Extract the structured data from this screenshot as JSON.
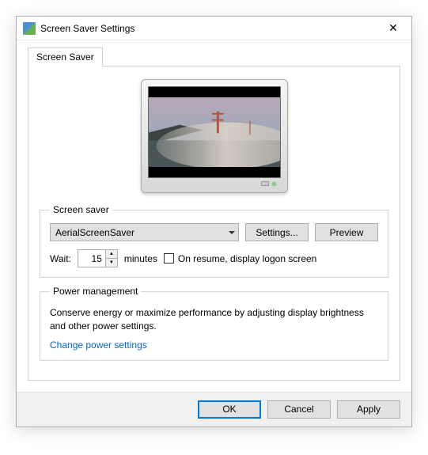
{
  "window": {
    "title": "Screen Saver Settings"
  },
  "tab": {
    "label": "Screen Saver"
  },
  "screensaver_group": {
    "legend": "Screen saver",
    "selected": "AerialScreenSaver",
    "settings_btn": "Settings...",
    "preview_btn": "Preview",
    "wait_label": "Wait:",
    "wait_value": "15",
    "wait_unit": "minutes",
    "resume_label": "On resume, display logon screen",
    "resume_checked": false
  },
  "power_group": {
    "legend": "Power management",
    "desc": "Conserve energy or maximize performance by adjusting display brightness and other power settings.",
    "link": "Change power settings"
  },
  "buttons": {
    "ok": "OK",
    "cancel": "Cancel",
    "apply": "Apply"
  }
}
